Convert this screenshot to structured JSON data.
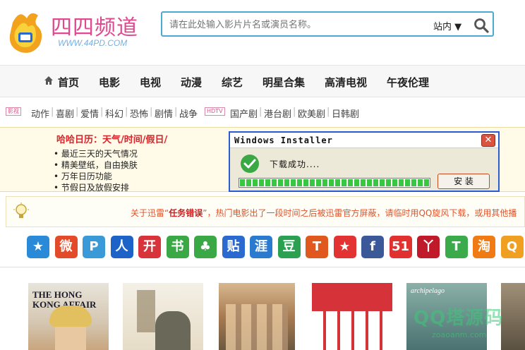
{
  "header": {
    "logo_title": "四四频道",
    "logo_url": "WWW.44PD.COM",
    "search_placeholder": "请在此处输入影片片名或演员名称。",
    "search_scope": "站内 ▼"
  },
  "nav": {
    "items": [
      "首页",
      "电影",
      "电视",
      "动漫",
      "综艺",
      "明星合集",
      "高清电视",
      "午夜伦理"
    ]
  },
  "subnav": {
    "movie_tag": "影视",
    "movie_items": [
      "动作",
      "喜剧",
      "爱情",
      "科幻",
      "恐怖",
      "剧情",
      "战争"
    ],
    "tv_tag": "HDTV",
    "tv_items": [
      "国产剧",
      "港台剧",
      "欧美剧",
      "日韩剧"
    ]
  },
  "promo": {
    "title": "哈哈日历：天气/时间/假日/",
    "lines": [
      "• 最近三天的天气情况",
      "• 精美壁纸，自由换肤",
      "• 万年日历功能",
      "• 节假日及放假安排"
    ]
  },
  "dialog": {
    "title": "Windows Installer",
    "message": "下载成功....",
    "progress": 1.0,
    "button": "安 装"
  },
  "notice": {
    "text_a": "关于迅雷“",
    "text_bold": "任务错误",
    "text_b": "”，热门电影出了一段时间之后被迅雷官方屏蔽，请临时用QQ旋风下载，或用其他播"
  },
  "sites": [
    {
      "name": "qq-zone",
      "glyph": "★",
      "color": "#2a8ad8"
    },
    {
      "name": "sina-weibo",
      "glyph": "微",
      "color": "#e24a2a"
    },
    {
      "name": "tencent-weibo",
      "glyph": "P",
      "color": "#3a9ad8"
    },
    {
      "name": "renren",
      "glyph": "人",
      "color": "#1d62c7"
    },
    {
      "name": "kaixin",
      "glyph": "开",
      "color": "#d8323a"
    },
    {
      "name": "douban-book",
      "glyph": "书",
      "color": "#3aa845"
    },
    {
      "name": "clover",
      "glyph": "♣",
      "color": "#3aa845"
    },
    {
      "name": "tieba",
      "glyph": "贴",
      "color": "#2a6ad0"
    },
    {
      "name": "ya",
      "glyph": "涯",
      "color": "#2a7ad0"
    },
    {
      "name": "douban",
      "glyph": "豆",
      "color": "#2aa050"
    },
    {
      "name": "t-app",
      "glyph": "T",
      "color": "#e0581e"
    },
    {
      "name": "star",
      "glyph": "★",
      "color": "#e23232"
    },
    {
      "name": "facebook",
      "glyph": "f",
      "color": "#3b5998"
    },
    {
      "name": "51",
      "glyph": "51",
      "color": "#e03030"
    },
    {
      "name": "wo",
      "glyph": "丫",
      "color": "#c01a2a"
    },
    {
      "name": "t-green",
      "glyph": "T",
      "color": "#3aaa4a"
    },
    {
      "name": "taobao",
      "glyph": "淘",
      "color": "#f07a14"
    },
    {
      "name": "q-orange",
      "glyph": "Q",
      "color": "#f0a020"
    }
  ],
  "posters": [
    {
      "caption": "THE HONG KONG AFFAIR",
      "bg": "#d8cfc0"
    },
    {
      "caption": "",
      "bg": "#e8e2d2"
    },
    {
      "caption": "",
      "bg": "#c8a27a"
    },
    {
      "caption": "",
      "bg": "#d8333a"
    },
    {
      "caption": "archipelago",
      "bg": "#5a8a8a"
    },
    {
      "caption": "",
      "bg": "#7a7060"
    }
  ],
  "watermark": {
    "main": "QQ塔源码",
    "sub": "zoaoanm.com"
  }
}
